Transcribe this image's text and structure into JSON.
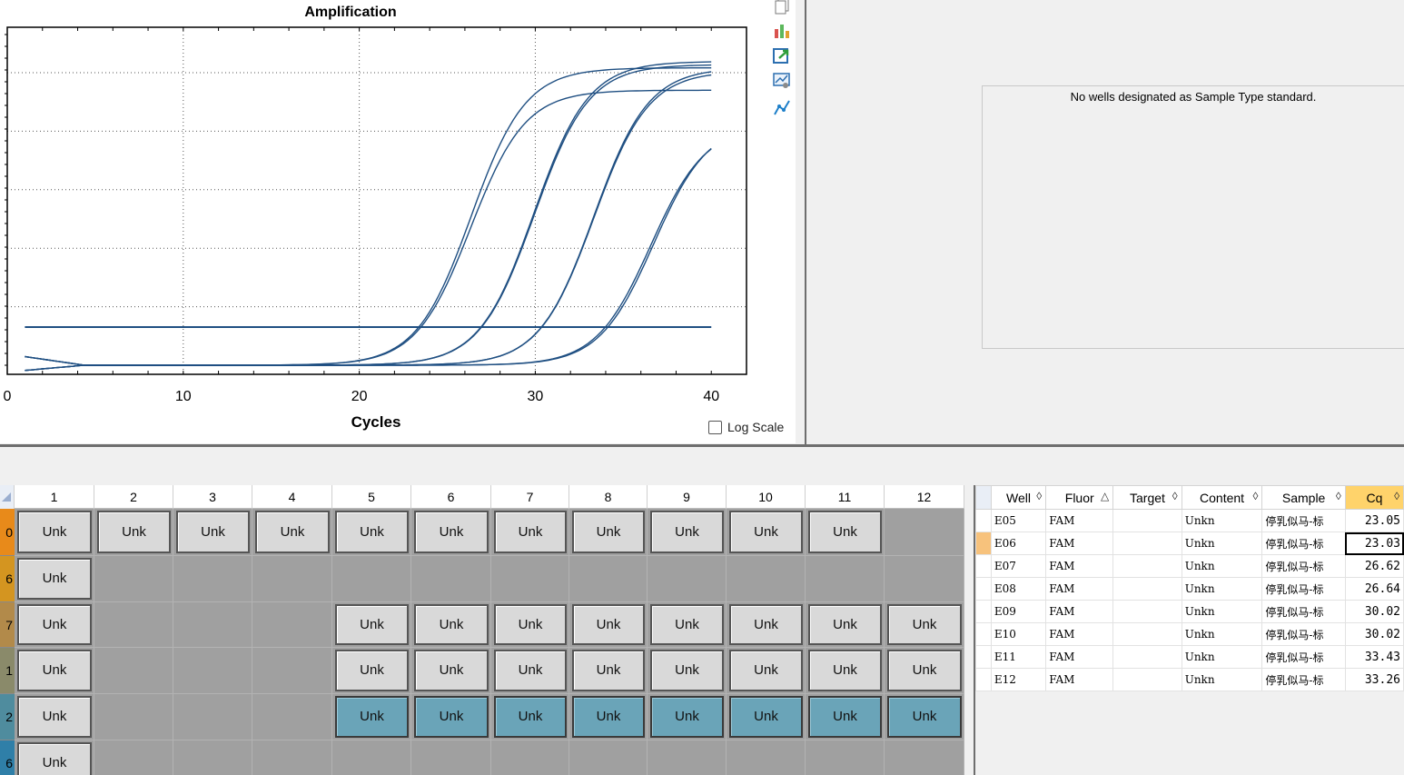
{
  "chart": {
    "title": "Amplification",
    "xlabel": "Cycles",
    "log_scale_label": "Log Scale",
    "log_scale_checked": false
  },
  "chart_data": {
    "type": "line",
    "title": "Amplification",
    "xlabel": "Cycles",
    "ylabel": "",
    "xlim": [
      0,
      42
    ],
    "x_ticks": [
      "0",
      "10",
      "20",
      "30",
      "40"
    ],
    "grid": true,
    "threshold_line": true,
    "series": [
      {
        "cq": 23.05,
        "plateau": 0.93
      },
      {
        "cq": 23.03,
        "plateau": 0.86
      },
      {
        "cq": 26.62,
        "plateau": 0.95
      },
      {
        "cq": 26.64,
        "plateau": 0.94
      },
      {
        "cq": 30.02,
        "plateau": 0.93
      },
      {
        "cq": 30.02,
        "plateau": 0.92
      },
      {
        "cq": 33.43,
        "plateau": 0.76
      },
      {
        "cq": 33.26,
        "plateau": 0.75
      }
    ],
    "color": "#1f4f82"
  },
  "toolbar": {
    "icons": [
      "copy-icon",
      "export-chart-icon",
      "export-data-icon",
      "chart-settings-icon",
      "line-style-icon"
    ]
  },
  "standard_curve": {
    "message": "No wells designated as Sample Type standard."
  },
  "plate": {
    "columns": [
      "1",
      "2",
      "3",
      "4",
      "5",
      "6",
      "7",
      "8",
      "9",
      "10",
      "11",
      "12"
    ],
    "row_labels": [
      "0",
      "6",
      "7",
      "1",
      "2",
      "6"
    ],
    "row_colors": [
      "#e88a1a",
      "#d49520",
      "#b28a4a",
      "#8a8a6a",
      "#4f8c9e",
      "#2f7fa8"
    ],
    "well_label": "Unk",
    "rows": [
      [
        true,
        true,
        true,
        true,
        true,
        true,
        true,
        true,
        true,
        true,
        true,
        false
      ],
      [
        true,
        false,
        false,
        false,
        false,
        false,
        false,
        false,
        false,
        false,
        false,
        false
      ],
      [
        true,
        false,
        false,
        false,
        true,
        true,
        true,
        true,
        true,
        true,
        true,
        true
      ],
      [
        true,
        false,
        false,
        false,
        true,
        true,
        true,
        true,
        true,
        true,
        true,
        true
      ],
      [
        true,
        false,
        false,
        false,
        true,
        true,
        true,
        true,
        true,
        true,
        true,
        true
      ],
      [
        true,
        false,
        false,
        false,
        false,
        false,
        false,
        false,
        false,
        false,
        false,
        false
      ]
    ],
    "selected_row": 4,
    "selected_from_col": 4
  },
  "results": {
    "columns": [
      {
        "label": "Well",
        "arrow": "◊"
      },
      {
        "label": "Fluor",
        "arrow": "△"
      },
      {
        "label": "Target",
        "arrow": "◊"
      },
      {
        "label": "Content",
        "arrow": "◊"
      },
      {
        "label": "Sample",
        "arrow": "◊"
      },
      {
        "label": "Cq",
        "arrow": "◊"
      }
    ],
    "rows": [
      [
        "E05",
        "FAM",
        "",
        "Unkn",
        "停乳似马-标",
        "23.05"
      ],
      [
        "E06",
        "FAM",
        "",
        "Unkn",
        "停乳似马-标",
        "23.03"
      ],
      [
        "E07",
        "FAM",
        "",
        "Unkn",
        "停乳似马-标",
        "26.62"
      ],
      [
        "E08",
        "FAM",
        "",
        "Unkn",
        "停乳似马-标",
        "26.64"
      ],
      [
        "E09",
        "FAM",
        "",
        "Unkn",
        "停乳似马-标",
        "30.02"
      ],
      [
        "E10",
        "FAM",
        "",
        "Unkn",
        "停乳似马-标",
        "30.02"
      ],
      [
        "E11",
        "FAM",
        "",
        "Unkn",
        "停乳似马-标",
        "33.43"
      ],
      [
        "E12",
        "FAM",
        "",
        "Unkn",
        "停乳似马-标",
        "33.26"
      ]
    ],
    "active_row": 1
  }
}
